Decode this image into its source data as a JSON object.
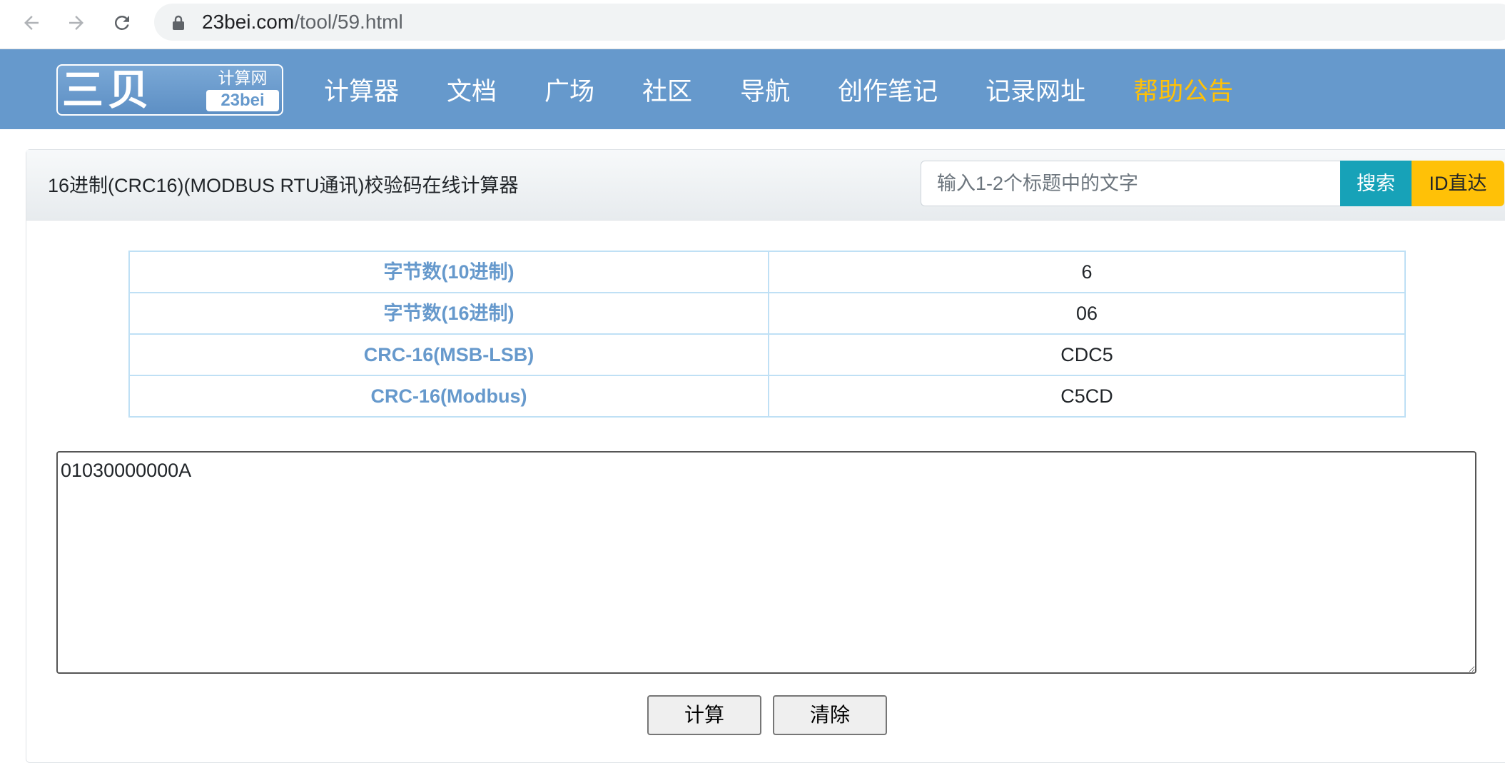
{
  "browser": {
    "url_host": "23bei.com",
    "url_path": "/tool/59.html"
  },
  "site": {
    "logo_main": "三贝",
    "logo_sub": "计算网",
    "logo_en": "23bei",
    "menu": [
      {
        "label": "计算器"
      },
      {
        "label": "文档"
      },
      {
        "label": "广场"
      },
      {
        "label": "社区"
      },
      {
        "label": "导航"
      },
      {
        "label": "创作笔记"
      },
      {
        "label": "记录网址"
      },
      {
        "label": "帮助公告"
      }
    ],
    "highlight_color": "#ffc107",
    "header_color": "#6699cc"
  },
  "card": {
    "title": "16进制(CRC16)(MODBUS RTU通讯)校验码在线计算器",
    "search_placeholder": "输入1-2个标题中的文字",
    "search_button": "搜索",
    "id_button": "ID直达"
  },
  "results": [
    {
      "label": "字节数(10进制)",
      "value": "6"
    },
    {
      "label": "字节数(16进制)",
      "value": "06"
    },
    {
      "label": "CRC-16(MSB-LSB)",
      "value": "CDC5"
    },
    {
      "label": "CRC-16(Modbus)",
      "value": "C5CD"
    }
  ],
  "input": {
    "value": "01030000000A"
  },
  "actions": {
    "calculate": "计算",
    "clear": "清除"
  }
}
